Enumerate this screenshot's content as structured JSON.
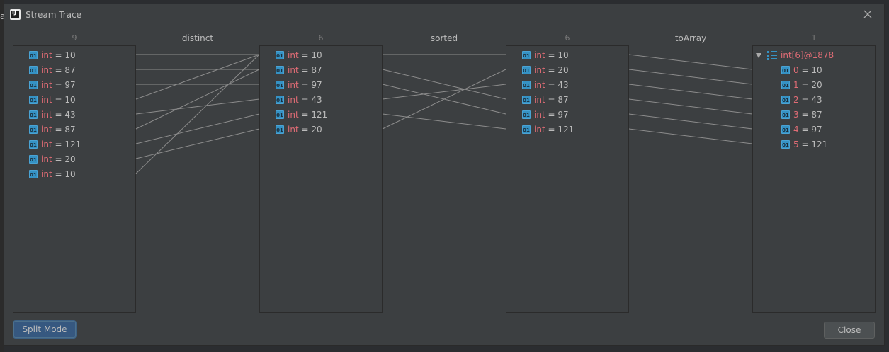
{
  "window": {
    "title": "Stream Trace",
    "app_icon": "intellij-idea-icon",
    "close_icon": "close-icon"
  },
  "outer_edge_glyph": "a",
  "columns": [
    {
      "count": "9",
      "items": [
        {
          "name": "int",
          "value": "10"
        },
        {
          "name": "int",
          "value": "87"
        },
        {
          "name": "int",
          "value": "97"
        },
        {
          "name": "int",
          "value": "10"
        },
        {
          "name": "int",
          "value": "43"
        },
        {
          "name": "int",
          "value": "87"
        },
        {
          "name": "int",
          "value": "121"
        },
        {
          "name": "int",
          "value": "20"
        },
        {
          "name": "int",
          "value": "10"
        }
      ]
    },
    {
      "count": "6",
      "items": [
        {
          "name": "int",
          "value": "10"
        },
        {
          "name": "int",
          "value": "87"
        },
        {
          "name": "int",
          "value": "97"
        },
        {
          "name": "int",
          "value": "43"
        },
        {
          "name": "int",
          "value": "121"
        },
        {
          "name": "int",
          "value": "20"
        }
      ]
    },
    {
      "count": "6",
      "items": [
        {
          "name": "int",
          "value": "10"
        },
        {
          "name": "int",
          "value": "20"
        },
        {
          "name": "int",
          "value": "43"
        },
        {
          "name": "int",
          "value": "87"
        },
        {
          "name": "int",
          "value": "97"
        },
        {
          "name": "int",
          "value": "121"
        }
      ]
    },
    {
      "count": "1",
      "array_label": "int[6]@1878",
      "items": [
        {
          "name": "0",
          "value": "10"
        },
        {
          "name": "1",
          "value": "20"
        },
        {
          "name": "2",
          "value": "43"
        },
        {
          "name": "3",
          "value": "87"
        },
        {
          "name": "4",
          "value": "97"
        },
        {
          "name": "5",
          "value": "121"
        }
      ]
    }
  ],
  "operations": [
    "distinct",
    "sorted",
    "toArray"
  ],
  "mappings": [
    [
      [
        0,
        0
      ],
      [
        1,
        1
      ],
      [
        2,
        2
      ],
      [
        3,
        0
      ],
      [
        4,
        3
      ],
      [
        5,
        1
      ],
      [
        6,
        4
      ],
      [
        7,
        5
      ],
      [
        8,
        0
      ]
    ],
    [
      [
        0,
        0
      ],
      [
        1,
        3
      ],
      [
        2,
        4
      ],
      [
        3,
        2
      ],
      [
        4,
        5
      ],
      [
        5,
        1
      ]
    ],
    [
      [
        0,
        0
      ],
      [
        1,
        1
      ],
      [
        2,
        2
      ],
      [
        3,
        3
      ],
      [
        4,
        4
      ],
      [
        5,
        5
      ]
    ]
  ],
  "buttons": {
    "split_mode": "Split Mode",
    "close": "Close"
  },
  "colors": {
    "background": "#3c3f41",
    "primitive_icon": "#3592c4",
    "name_text": "#e06c75",
    "value_text": "#bbbbbb",
    "link_line": "#8c8c8c",
    "split_button": "#365880"
  }
}
